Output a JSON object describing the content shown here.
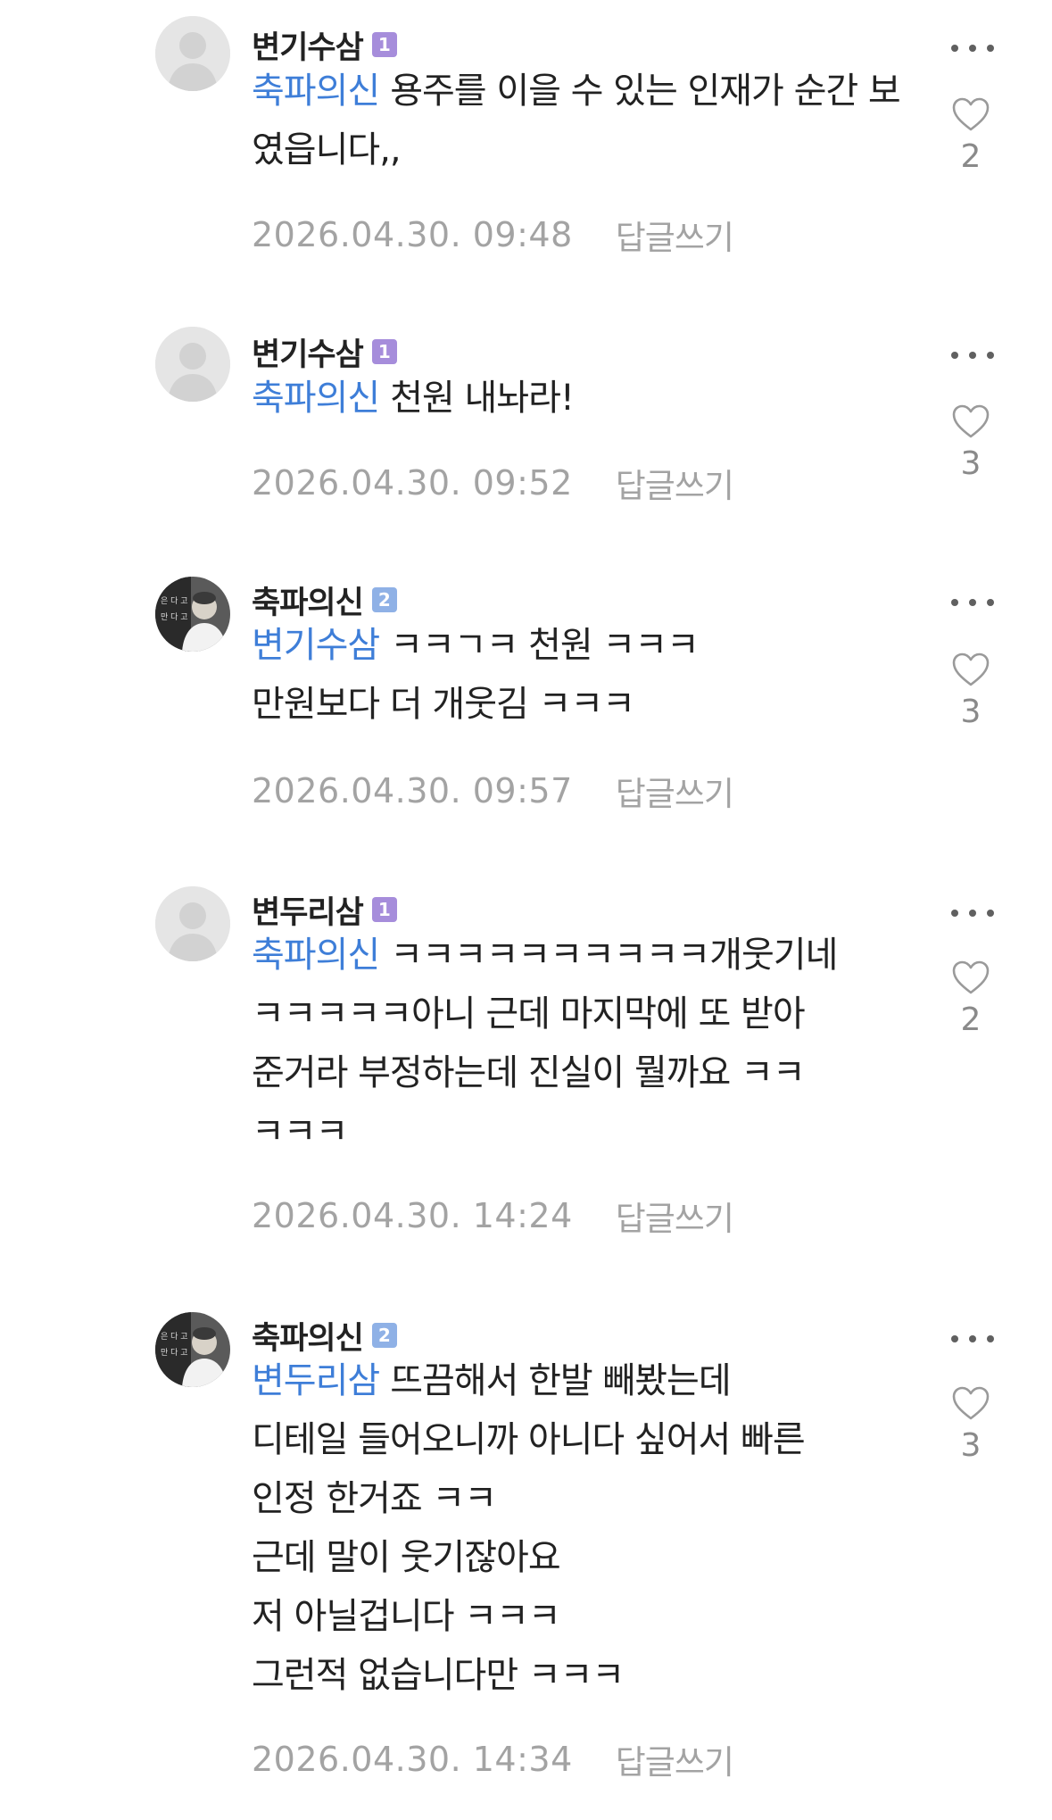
{
  "comments": [
    {
      "author": "변기수삼",
      "level": "1",
      "mention": "축파의신",
      "text": "용주를 이을 수 있는 인재가 순간 보였읍니다,,",
      "date": "2026.04.30. 09:48",
      "reply_label": "답글쓰기",
      "likes": "2",
      "avatar": "default-avatar"
    },
    {
      "author": "변기수삼",
      "level": "1",
      "mention": "축파의신",
      "text": "천원 내놔라!",
      "date": "2026.04.30. 09:52",
      "reply_label": "답글쓰기",
      "likes": "3",
      "avatar": "default-avatar"
    },
    {
      "author": "축파의신",
      "level": "2",
      "mention": "변기수삼",
      "text": "ㅋㅋㄱㅋ 천원 ㅋㅋㅋ\n만원보다 더 개웃김 ㅋㅋㅋ",
      "date": "2026.04.30. 09:57",
      "reply_label": "답글쓰기",
      "likes": "3",
      "avatar": "profile-photo-avatar"
    },
    {
      "author": "변두리삼",
      "level": "1",
      "mention": "축파의신",
      "text": "ㅋㅋㅋㅋㅋㅋㅋㅋㅋㅋ개웃기네\nㅋㅋㅋㅋㅋ아니 근데 마지막에 또 받아\n준거라 부정하는데 진실이 뭘까요 ㅋㅋ\nㅋㅋㅋ",
      "date": "2026.04.30. 14:24",
      "reply_label": "답글쓰기",
      "likes": "2",
      "avatar": "default-avatar"
    },
    {
      "author": "축파의신",
      "level": "2",
      "mention": "변두리삼",
      "text": "뜨끔해서 한발 빼봤는데\n디테일 들어오니까 아니다 싶어서 빠른\n인정 한거죠 ㅋㅋ\n근데 말이 웃기잖아요\n저 아닐겁니다 ㅋㅋㅋ\n그런적 없습니다만 ㅋㅋㅋ",
      "date": "2026.04.30. 14:34",
      "reply_label": "답글쓰기",
      "likes": "3",
      "avatar": "profile-photo-avatar"
    }
  ],
  "colors": {
    "mention": "#3e7ed8",
    "meta": "#a3a3a3",
    "level1": "#a68ddb",
    "level2": "#8fb1e6"
  },
  "icons": {
    "more": "more-icon",
    "like": "heart-outline-icon"
  }
}
